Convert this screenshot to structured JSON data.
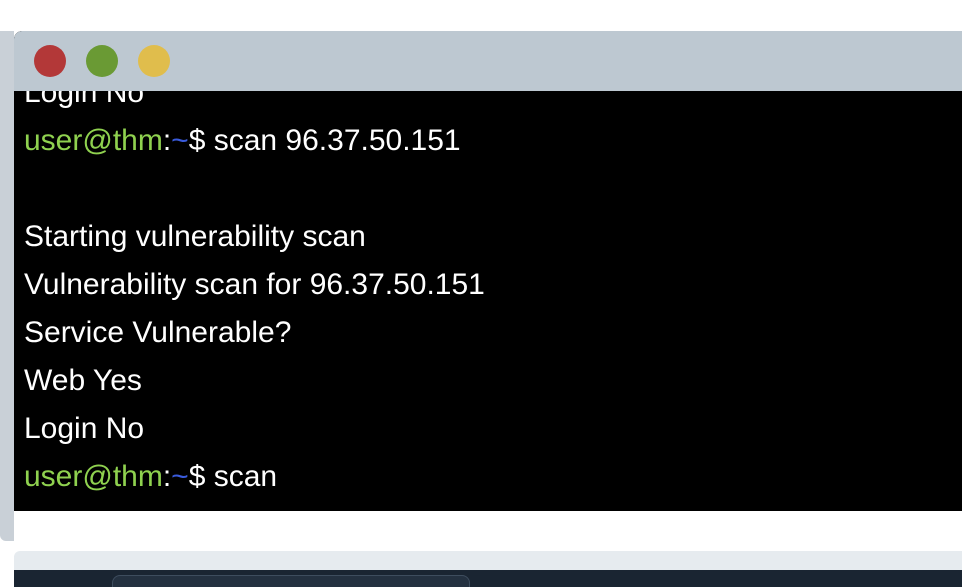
{
  "window": {
    "controls": {
      "close": "red-dot",
      "minimize": "green-dot",
      "zoom": "yellow-dot"
    }
  },
  "terminal": {
    "lines": [
      {
        "type": "output",
        "text": "Login No"
      },
      {
        "type": "prompt",
        "user": "user@thm",
        "sep": ":",
        "path": "~",
        "dollar": "$",
        "command": " scan 96.37.50.151"
      },
      {
        "type": "output",
        "text": ""
      },
      {
        "type": "output",
        "text": "Starting vulnerability scan"
      },
      {
        "type": "output",
        "text": "Vulnerability scan for 96.37.50.151"
      },
      {
        "type": "output",
        "text": "Service Vulnerable?"
      },
      {
        "type": "output",
        "text": "Web Yes"
      },
      {
        "type": "output",
        "text": "Login No"
      },
      {
        "type": "prompt",
        "user": "user@thm",
        "sep": ":",
        "path": "~",
        "dollar": "$",
        "command": " scan"
      }
    ]
  },
  "colors": {
    "prompt_user": "#8fd14f",
    "prompt_path": "#3a5bdc",
    "terminal_bg": "#000000",
    "titlebar_bg": "#bdc8d1"
  }
}
